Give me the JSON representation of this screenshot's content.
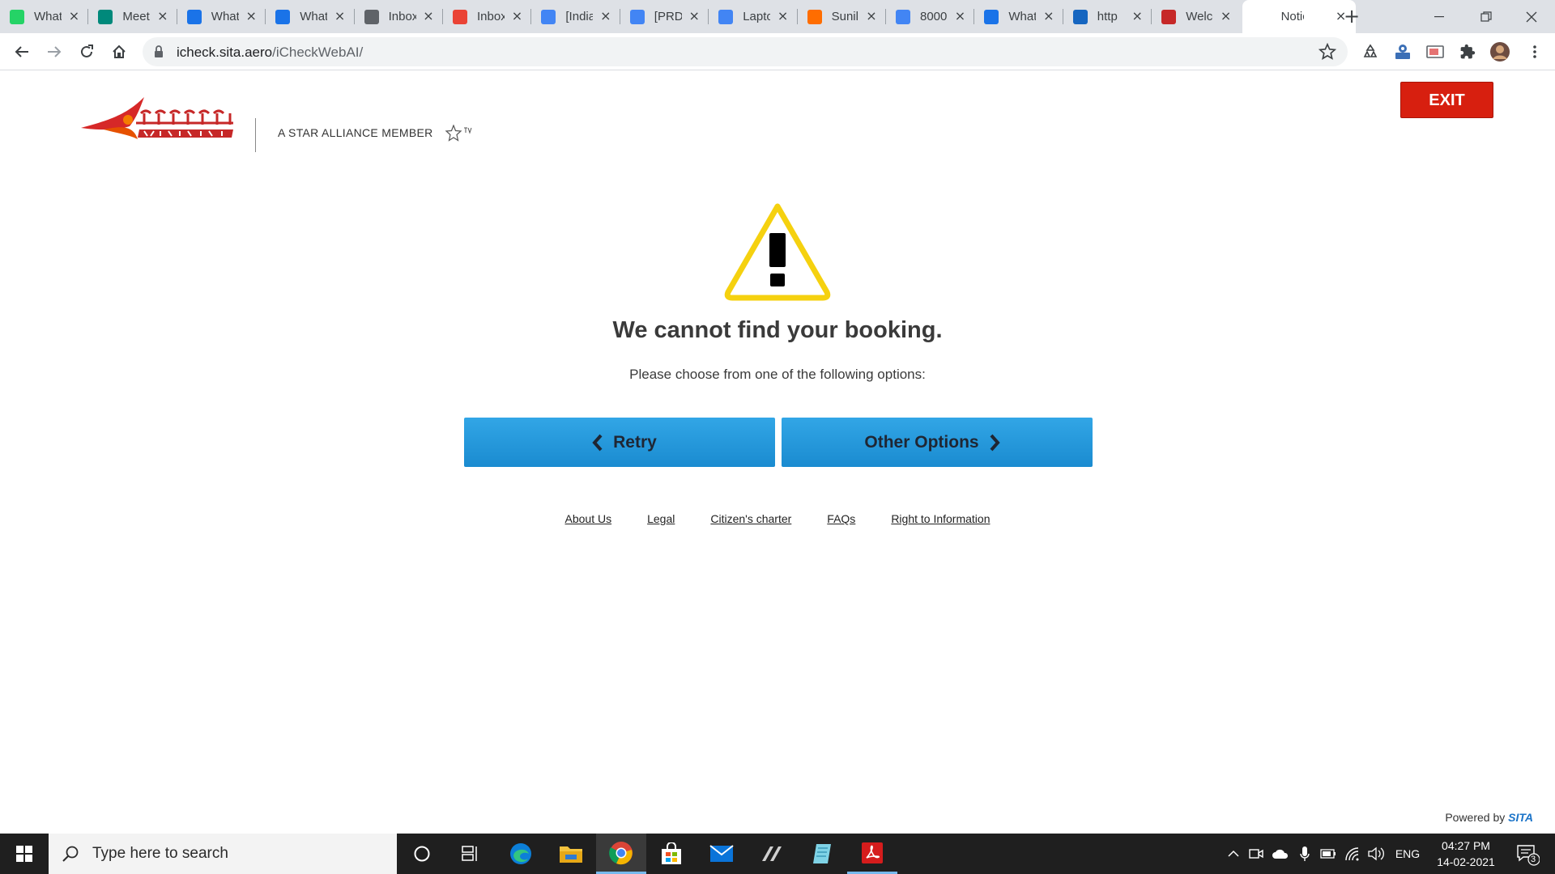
{
  "browser": {
    "tabs": [
      {
        "title": "WhatsApp",
        "favicon": "whatsapp-icon",
        "color": "#25d366"
      },
      {
        "title": "Meet",
        "favicon": "meet-icon",
        "color": "#00897b"
      },
      {
        "title": "WhatsApp",
        "favicon": "whatsapp-link-icon",
        "color": "#1a73e8"
      },
      {
        "title": "WhatsApp",
        "favicon": "whatsapp-link-icon",
        "color": "#1a73e8"
      },
      {
        "title": "Inbox",
        "favicon": "scissors-icon",
        "color": "#5f6368"
      },
      {
        "title": "Inbox",
        "favicon": "gmail-icon",
        "color": "#ea4335"
      },
      {
        "title": "[India]",
        "favicon": "docs-icon",
        "color": "#4285f4"
      },
      {
        "title": "[PRD]",
        "favicon": "docs-icon",
        "color": "#4285f4"
      },
      {
        "title": "Laptop",
        "favicon": "docs-icon",
        "color": "#4285f4"
      },
      {
        "title": "Sunil",
        "favicon": "justdial-icon",
        "color": "#ff6d00"
      },
      {
        "title": "8000",
        "favicon": "google-icon",
        "color": "#4285f4"
      },
      {
        "title": "WhatsApp",
        "favicon": "whatsapp-link-icon",
        "color": "#1a73e8"
      },
      {
        "title": "http",
        "favicon": "u-icon",
        "color": "#1565c0"
      },
      {
        "title": "Welcome",
        "favicon": "airindia-icon",
        "color": "#c62828"
      },
      {
        "title": "Notice",
        "favicon": "none",
        "color": "#ffffff"
      }
    ],
    "url_host": "icheck.sita.aero",
    "url_path": "/iCheckWebAI/"
  },
  "page": {
    "star_alliance_text": "A STAR ALLIANCE MEMBER",
    "exit_label": "EXIT",
    "title": "We cannot find your booking.",
    "subtitle": "Please choose from one of the following options:",
    "retry_label": "Retry",
    "other_options_label": "Other Options",
    "footer_links": [
      "About Us",
      "Legal",
      "Citizen's charter",
      "FAQs",
      "Right to Information"
    ],
    "powered_by": "Powered by",
    "powered_by_brand": "SITA"
  },
  "taskbar": {
    "search_placeholder": "Type here to search",
    "language": "ENG",
    "time": "04:27 PM",
    "date": "14-02-2021",
    "notification_count": "3"
  },
  "colors": {
    "exit_red": "#d71f0f",
    "button_blue": "#2196d9",
    "warning_yellow": "#f5d10f"
  }
}
